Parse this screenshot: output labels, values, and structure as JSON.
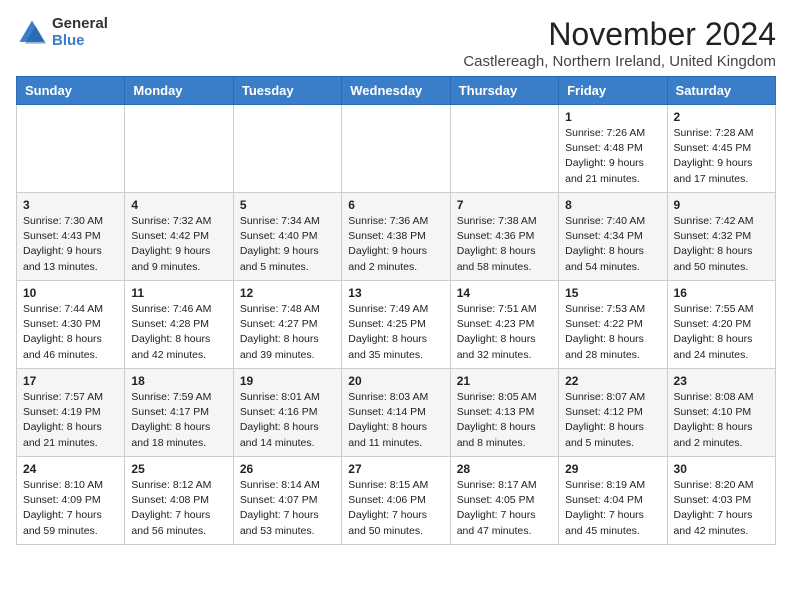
{
  "logo": {
    "general": "General",
    "blue": "Blue"
  },
  "title": "November 2024",
  "subtitle": "Castlereagh, Northern Ireland, United Kingdom",
  "days_of_week": [
    "Sunday",
    "Monday",
    "Tuesday",
    "Wednesday",
    "Thursday",
    "Friday",
    "Saturday"
  ],
  "weeks": [
    [
      {
        "day": "",
        "info": ""
      },
      {
        "day": "",
        "info": ""
      },
      {
        "day": "",
        "info": ""
      },
      {
        "day": "",
        "info": ""
      },
      {
        "day": "",
        "info": ""
      },
      {
        "day": "1",
        "info": "Sunrise: 7:26 AM\nSunset: 4:48 PM\nDaylight: 9 hours\nand 21 minutes."
      },
      {
        "day": "2",
        "info": "Sunrise: 7:28 AM\nSunset: 4:45 PM\nDaylight: 9 hours\nand 17 minutes."
      }
    ],
    [
      {
        "day": "3",
        "info": "Sunrise: 7:30 AM\nSunset: 4:43 PM\nDaylight: 9 hours\nand 13 minutes."
      },
      {
        "day": "4",
        "info": "Sunrise: 7:32 AM\nSunset: 4:42 PM\nDaylight: 9 hours\nand 9 minutes."
      },
      {
        "day": "5",
        "info": "Sunrise: 7:34 AM\nSunset: 4:40 PM\nDaylight: 9 hours\nand 5 minutes."
      },
      {
        "day": "6",
        "info": "Sunrise: 7:36 AM\nSunset: 4:38 PM\nDaylight: 9 hours\nand 2 minutes."
      },
      {
        "day": "7",
        "info": "Sunrise: 7:38 AM\nSunset: 4:36 PM\nDaylight: 8 hours\nand 58 minutes."
      },
      {
        "day": "8",
        "info": "Sunrise: 7:40 AM\nSunset: 4:34 PM\nDaylight: 8 hours\nand 54 minutes."
      },
      {
        "day": "9",
        "info": "Sunrise: 7:42 AM\nSunset: 4:32 PM\nDaylight: 8 hours\nand 50 minutes."
      }
    ],
    [
      {
        "day": "10",
        "info": "Sunrise: 7:44 AM\nSunset: 4:30 PM\nDaylight: 8 hours\nand 46 minutes."
      },
      {
        "day": "11",
        "info": "Sunrise: 7:46 AM\nSunset: 4:28 PM\nDaylight: 8 hours\nand 42 minutes."
      },
      {
        "day": "12",
        "info": "Sunrise: 7:48 AM\nSunset: 4:27 PM\nDaylight: 8 hours\nand 39 minutes."
      },
      {
        "day": "13",
        "info": "Sunrise: 7:49 AM\nSunset: 4:25 PM\nDaylight: 8 hours\nand 35 minutes."
      },
      {
        "day": "14",
        "info": "Sunrise: 7:51 AM\nSunset: 4:23 PM\nDaylight: 8 hours\nand 32 minutes."
      },
      {
        "day": "15",
        "info": "Sunrise: 7:53 AM\nSunset: 4:22 PM\nDaylight: 8 hours\nand 28 minutes."
      },
      {
        "day": "16",
        "info": "Sunrise: 7:55 AM\nSunset: 4:20 PM\nDaylight: 8 hours\nand 24 minutes."
      }
    ],
    [
      {
        "day": "17",
        "info": "Sunrise: 7:57 AM\nSunset: 4:19 PM\nDaylight: 8 hours\nand 21 minutes."
      },
      {
        "day": "18",
        "info": "Sunrise: 7:59 AM\nSunset: 4:17 PM\nDaylight: 8 hours\nand 18 minutes."
      },
      {
        "day": "19",
        "info": "Sunrise: 8:01 AM\nSunset: 4:16 PM\nDaylight: 8 hours\nand 14 minutes."
      },
      {
        "day": "20",
        "info": "Sunrise: 8:03 AM\nSunset: 4:14 PM\nDaylight: 8 hours\nand 11 minutes."
      },
      {
        "day": "21",
        "info": "Sunrise: 8:05 AM\nSunset: 4:13 PM\nDaylight: 8 hours\nand 8 minutes."
      },
      {
        "day": "22",
        "info": "Sunrise: 8:07 AM\nSunset: 4:12 PM\nDaylight: 8 hours\nand 5 minutes."
      },
      {
        "day": "23",
        "info": "Sunrise: 8:08 AM\nSunset: 4:10 PM\nDaylight: 8 hours\nand 2 minutes."
      }
    ],
    [
      {
        "day": "24",
        "info": "Sunrise: 8:10 AM\nSunset: 4:09 PM\nDaylight: 7 hours\nand 59 minutes."
      },
      {
        "day": "25",
        "info": "Sunrise: 8:12 AM\nSunset: 4:08 PM\nDaylight: 7 hours\nand 56 minutes."
      },
      {
        "day": "26",
        "info": "Sunrise: 8:14 AM\nSunset: 4:07 PM\nDaylight: 7 hours\nand 53 minutes."
      },
      {
        "day": "27",
        "info": "Sunrise: 8:15 AM\nSunset: 4:06 PM\nDaylight: 7 hours\nand 50 minutes."
      },
      {
        "day": "28",
        "info": "Sunrise: 8:17 AM\nSunset: 4:05 PM\nDaylight: 7 hours\nand 47 minutes."
      },
      {
        "day": "29",
        "info": "Sunrise: 8:19 AM\nSunset: 4:04 PM\nDaylight: 7 hours\nand 45 minutes."
      },
      {
        "day": "30",
        "info": "Sunrise: 8:20 AM\nSunset: 4:03 PM\nDaylight: 7 hours\nand 42 minutes."
      }
    ]
  ]
}
